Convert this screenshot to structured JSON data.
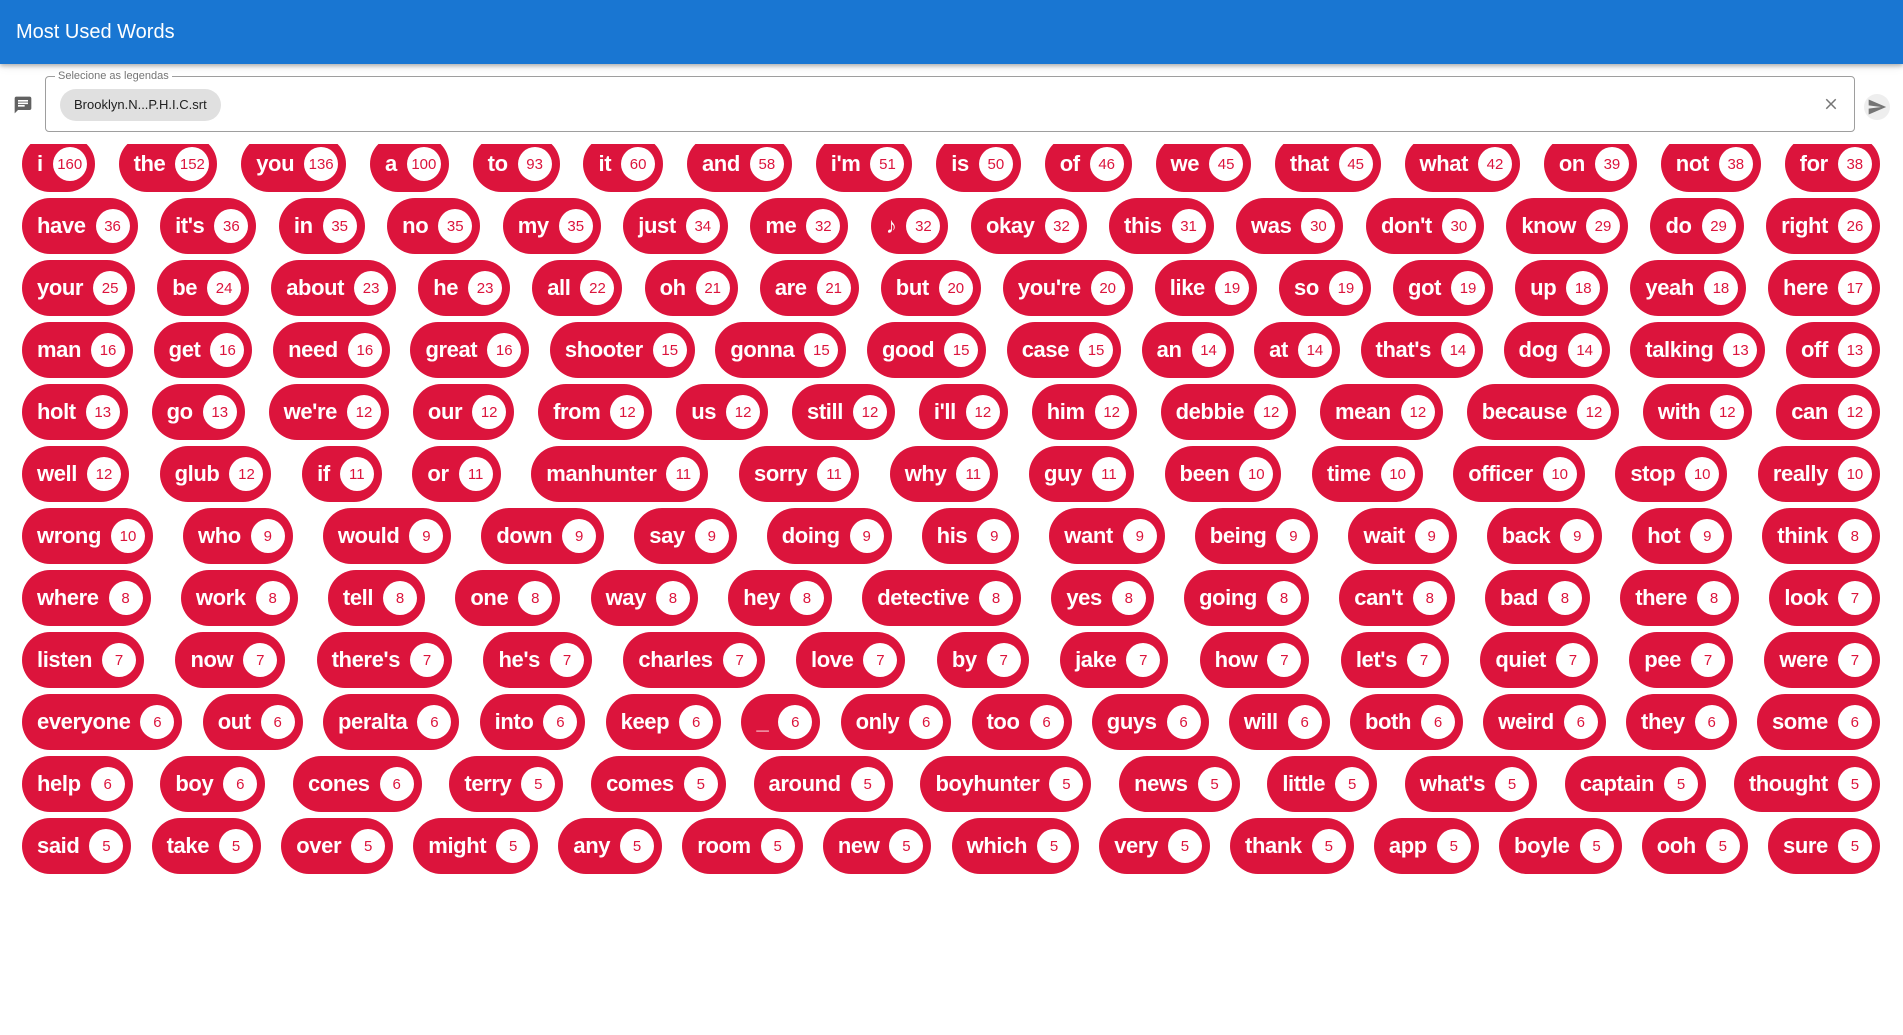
{
  "app": {
    "title": "Most Used Words"
  },
  "filter": {
    "legend": "Selecione as legendas",
    "selected_file": "Brooklyn.N...P.H.I.C.srt",
    "icons": {
      "subtitles": "subtitles-icon",
      "clear": "close-icon",
      "send": "send-icon"
    }
  },
  "colors": {
    "appbar": "#1976d2",
    "chip": "#dc143c",
    "count_bubble": "#ffffff",
    "file_chip": "#e0e0e0"
  },
  "word_rows": [
    [
      [
        "i",
        "160"
      ],
      [
        "the",
        "152"
      ],
      [
        "you",
        "136"
      ],
      [
        "a",
        "100"
      ],
      [
        "to",
        "93"
      ],
      [
        "it",
        "60"
      ],
      [
        "and",
        "58"
      ],
      [
        "i'm",
        "51"
      ],
      [
        "is",
        "50"
      ],
      [
        "of",
        "46"
      ],
      [
        "we",
        "45"
      ],
      [
        "that",
        "45"
      ],
      [
        "what",
        "42"
      ],
      [
        "on",
        "39"
      ],
      [
        "not",
        "38"
      ],
      [
        "for",
        "38"
      ]
    ],
    [
      [
        "have",
        "36"
      ],
      [
        "it's",
        "36"
      ],
      [
        "in",
        "35"
      ],
      [
        "no",
        "35"
      ],
      [
        "my",
        "35"
      ],
      [
        "just",
        "34"
      ],
      [
        "me",
        "32"
      ],
      [
        "♪",
        "32"
      ],
      [
        "okay",
        "32"
      ],
      [
        "this",
        "31"
      ],
      [
        "was",
        "30"
      ],
      [
        "don't",
        "30"
      ],
      [
        "know",
        "29"
      ],
      [
        "do",
        "29"
      ],
      [
        "right",
        "26"
      ]
    ],
    [
      [
        "your",
        "25"
      ],
      [
        "be",
        "24"
      ],
      [
        "about",
        "23"
      ],
      [
        "he",
        "23"
      ],
      [
        "all",
        "22"
      ],
      [
        "oh",
        "21"
      ],
      [
        "are",
        "21"
      ],
      [
        "but",
        "20"
      ],
      [
        "you're",
        "20"
      ],
      [
        "like",
        "19"
      ],
      [
        "so",
        "19"
      ],
      [
        "got",
        "19"
      ],
      [
        "up",
        "18"
      ],
      [
        "yeah",
        "18"
      ],
      [
        "here",
        "17"
      ]
    ],
    [
      [
        "man",
        "16"
      ],
      [
        "get",
        "16"
      ],
      [
        "need",
        "16"
      ],
      [
        "great",
        "16"
      ],
      [
        "shooter",
        "15"
      ],
      [
        "gonna",
        "15"
      ],
      [
        "good",
        "15"
      ],
      [
        "case",
        "15"
      ],
      [
        "an",
        "14"
      ],
      [
        "at",
        "14"
      ],
      [
        "that's",
        "14"
      ],
      [
        "dog",
        "14"
      ],
      [
        "talking",
        "13"
      ],
      [
        "off",
        "13"
      ]
    ],
    [
      [
        "holt",
        "13"
      ],
      [
        "go",
        "13"
      ],
      [
        "we're",
        "12"
      ],
      [
        "our",
        "12"
      ],
      [
        "from",
        "12"
      ],
      [
        "us",
        "12"
      ],
      [
        "still",
        "12"
      ],
      [
        "i'll",
        "12"
      ],
      [
        "him",
        "12"
      ],
      [
        "debbie",
        "12"
      ],
      [
        "mean",
        "12"
      ],
      [
        "because",
        "12"
      ],
      [
        "with",
        "12"
      ],
      [
        "can",
        "12"
      ]
    ],
    [
      [
        "well",
        "12"
      ],
      [
        "glub",
        "12"
      ],
      [
        "if",
        "11"
      ],
      [
        "or",
        "11"
      ],
      [
        "manhunter",
        "11"
      ],
      [
        "sorry",
        "11"
      ],
      [
        "why",
        "11"
      ],
      [
        "guy",
        "11"
      ],
      [
        "been",
        "10"
      ],
      [
        "time",
        "10"
      ],
      [
        "officer",
        "10"
      ],
      [
        "stop",
        "10"
      ],
      [
        "really",
        "10"
      ]
    ],
    [
      [
        "wrong",
        "10"
      ],
      [
        "who",
        "9"
      ],
      [
        "would",
        "9"
      ],
      [
        "down",
        "9"
      ],
      [
        "say",
        "9"
      ],
      [
        "doing",
        "9"
      ],
      [
        "his",
        "9"
      ],
      [
        "want",
        "9"
      ],
      [
        "being",
        "9"
      ],
      [
        "wait",
        "9"
      ],
      [
        "back",
        "9"
      ],
      [
        "hot",
        "9"
      ],
      [
        "think",
        "8"
      ]
    ],
    [
      [
        "where",
        "8"
      ],
      [
        "work",
        "8"
      ],
      [
        "tell",
        "8"
      ],
      [
        "one",
        "8"
      ],
      [
        "way",
        "8"
      ],
      [
        "hey",
        "8"
      ],
      [
        "detective",
        "8"
      ],
      [
        "yes",
        "8"
      ],
      [
        "going",
        "8"
      ],
      [
        "can't",
        "8"
      ],
      [
        "bad",
        "8"
      ],
      [
        "there",
        "8"
      ],
      [
        "look",
        "7"
      ]
    ],
    [
      [
        "listen",
        "7"
      ],
      [
        "now",
        "7"
      ],
      [
        "there's",
        "7"
      ],
      [
        "he's",
        "7"
      ],
      [
        "charles",
        "7"
      ],
      [
        "love",
        "7"
      ],
      [
        "by",
        "7"
      ],
      [
        "jake",
        "7"
      ],
      [
        "how",
        "7"
      ],
      [
        "let's",
        "7"
      ],
      [
        "quiet",
        "7"
      ],
      [
        "pee",
        "7"
      ],
      [
        "were",
        "7"
      ]
    ],
    [
      [
        "everyone",
        "6"
      ],
      [
        "out",
        "6"
      ],
      [
        "peralta",
        "6"
      ],
      [
        "into",
        "6"
      ],
      [
        "keep",
        "6"
      ],
      [
        "_",
        "6"
      ],
      [
        "only",
        "6"
      ],
      [
        "too",
        "6"
      ],
      [
        "guys",
        "6"
      ],
      [
        "will",
        "6"
      ],
      [
        "both",
        "6"
      ],
      [
        "weird",
        "6"
      ],
      [
        "they",
        "6"
      ],
      [
        "some",
        "6"
      ]
    ],
    [
      [
        "help",
        "6"
      ],
      [
        "boy",
        "6"
      ],
      [
        "cones",
        "6"
      ],
      [
        "terry",
        "5"
      ],
      [
        "comes",
        "5"
      ],
      [
        "around",
        "5"
      ],
      [
        "boyhunter",
        "5"
      ],
      [
        "news",
        "5"
      ],
      [
        "little",
        "5"
      ],
      [
        "what's",
        "5"
      ],
      [
        "captain",
        "5"
      ],
      [
        "thought",
        "5"
      ]
    ],
    [
      [
        "said",
        "5"
      ],
      [
        "take",
        "5"
      ],
      [
        "over",
        "5"
      ],
      [
        "might",
        "5"
      ],
      [
        "any",
        "5"
      ],
      [
        "room",
        "5"
      ],
      [
        "new",
        "5"
      ],
      [
        "which",
        "5"
      ],
      [
        "very",
        "5"
      ],
      [
        "thank",
        "5"
      ],
      [
        "app",
        "5"
      ],
      [
        "boyle",
        "5"
      ],
      [
        "ooh",
        "5"
      ],
      [
        "sure",
        "5"
      ]
    ]
  ]
}
